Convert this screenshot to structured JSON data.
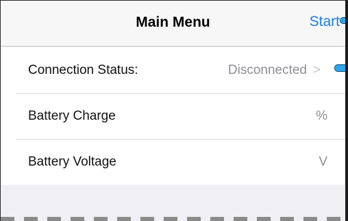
{
  "navbar": {
    "title": "Main Menu",
    "start_label": "Start"
  },
  "rows": [
    {
      "label": "Connection Status:",
      "value": "Disconnected",
      "chevron": ">"
    },
    {
      "label": "Battery Charge",
      "value": "%"
    },
    {
      "label": "Battery Voltage",
      "value": "V"
    }
  ],
  "colors": {
    "accent": "#1a7ee6",
    "secondary_text": "#8e8e93",
    "background": "#efeff4"
  }
}
